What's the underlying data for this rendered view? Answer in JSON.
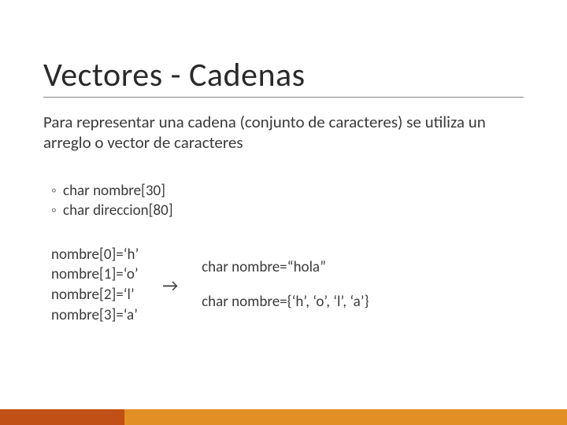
{
  "title": "Vectores - Cadenas",
  "intro": "Para representar una cadena (conjunto de caracteres) se utiliza un arreglo o vector de caracteres",
  "bullets": [
    "char nombre[30]",
    "char direccion[80]"
  ],
  "example": {
    "left": [
      "nombre[0]=‘h’",
      "nombre[1]=‘o’",
      "nombre[2]=‘l’",
      "nombre[3]=‘a’"
    ],
    "arrow": "→",
    "right": [
      "char nombre=“hola”",
      "char nombre={‘h’, ‘o’, ‘l’, ‘a’}"
    ]
  },
  "colors": {
    "accent1": "#c05016",
    "accent2": "#e28f24"
  }
}
